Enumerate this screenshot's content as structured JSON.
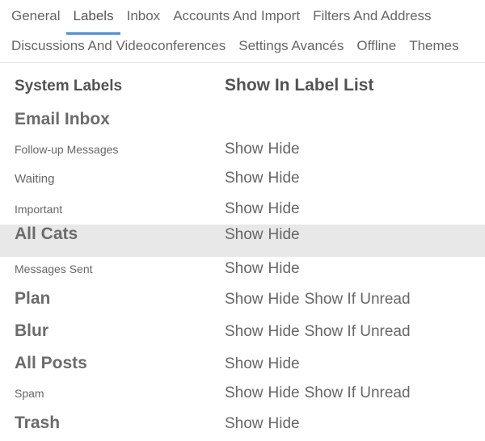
{
  "tabs": [
    {
      "label": "General"
    },
    {
      "label": "Labels"
    },
    {
      "label": "Inbox"
    },
    {
      "label": "Accounts And Import"
    },
    {
      "label": "Filters And Address"
    },
    {
      "label": "Discussions And Videoconferences"
    },
    {
      "label": "Settings Avancés"
    },
    {
      "label": "Offline"
    },
    {
      "label": "Themes"
    }
  ],
  "headers": {
    "left": "System Labels",
    "right": "Show In Label List"
  },
  "actions": {
    "show": "Show",
    "hide": "Hide",
    "show_if_unread": "Show If Unread"
  },
  "rows": [
    {
      "label": "Email Inbox",
      "size": "big",
      "actions": []
    },
    {
      "label": "Follow-up Messages",
      "size": "small",
      "actions": [
        "show",
        "hide"
      ]
    },
    {
      "label": "Waiting",
      "size": "mid",
      "actions": [
        "show",
        "hide"
      ]
    },
    {
      "label": "Important",
      "size": "small",
      "actions": [
        "show",
        "hide"
      ]
    },
    {
      "label": "All Cats",
      "size": "big",
      "highlight": true,
      "actions": [
        "show",
        "hide"
      ]
    },
    {
      "label": "Messages Sent",
      "size": "small",
      "actions": [
        "show",
        "hide"
      ]
    },
    {
      "label": "Plan",
      "size": "big",
      "actions": [
        "show",
        "hide",
        "show_if_unread"
      ]
    },
    {
      "label": "Blur",
      "size": "big",
      "actions": [
        "show",
        "hide",
        "show_if_unread"
      ]
    },
    {
      "label": "All Posts",
      "size": "big",
      "actions": [
        "show",
        "hide"
      ]
    },
    {
      "label": "Spam",
      "size": "small",
      "actions": [
        "show",
        "hide",
        "show_if_unread"
      ]
    },
    {
      "label": "Trash",
      "size": "big",
      "actions": [
        "show",
        "hide"
      ]
    }
  ]
}
